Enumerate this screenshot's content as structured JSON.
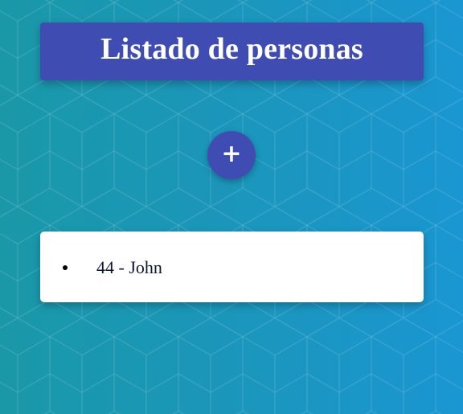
{
  "header": {
    "title": "Listado de personas"
  },
  "add_button": {
    "icon": "plus-icon",
    "symbol": "+"
  },
  "people": [
    {
      "label": "44 - John"
    }
  ],
  "colors": {
    "accent": "#3f4db3",
    "background_start": "#1a98a8",
    "background_end": "#1a96d2",
    "card": "#ffffff",
    "text": "#0e1733"
  }
}
